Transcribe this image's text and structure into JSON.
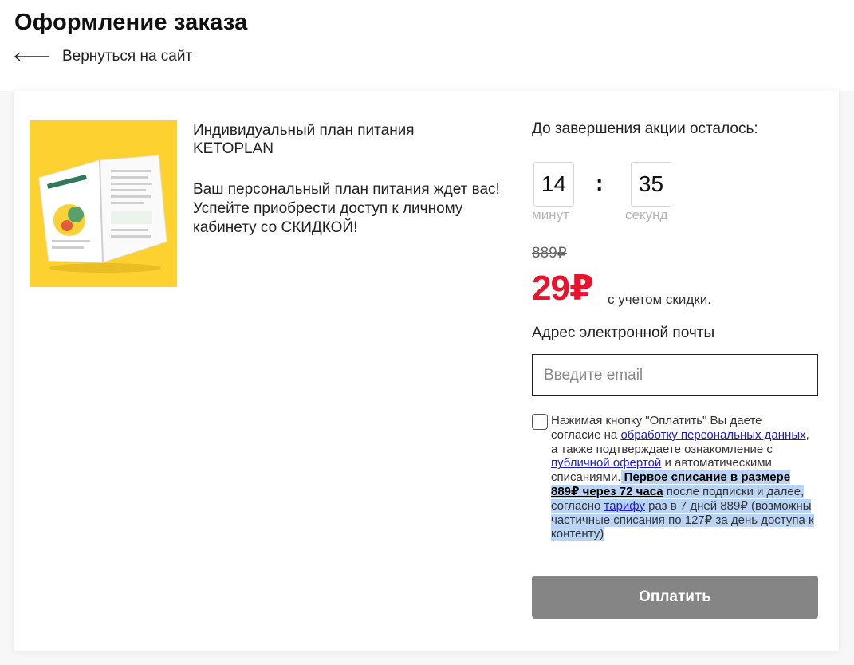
{
  "header": {
    "title": "Оформление заказа",
    "back_label": "Вернуться на сайт"
  },
  "product": {
    "name": "Индивидуальный план питания KETOPLAN",
    "description": "Ваш персональный план питания ждет вас! Успейте приобрести доступ к личному кабинету со СКИДКОЙ!",
    "image_bg": "#fdd230"
  },
  "timer": {
    "caption": "До завершения акции осталось:",
    "minutes": "14",
    "seconds": "35",
    "separator": ":",
    "minutes_label": "минут",
    "seconds_label": "секунд"
  },
  "price": {
    "old": "889₽",
    "new": "29₽",
    "note": "с учетом скидки.",
    "accent_color": "#e8132c"
  },
  "email": {
    "label": "Адрес электронной почты",
    "placeholder": "Введите email",
    "value": ""
  },
  "consent": {
    "checked": false,
    "text_1": "Нажимая кнопку \"Оплатить\" Вы даете согласие на ",
    "link_personal_data": "обработку персональных данных",
    "text_2": ", а также подтверждаете ознакомление с ",
    "link_offer": "публичной офертой",
    "text_3": " и автоматическими списаниями.",
    "bold_first_charge": "Первое списание в размере 889₽ через 72 часа",
    "text_4": " после подписки и далее, согласно ",
    "link_tariff": "тарифу",
    "text_5": " раз в 7 дней 889₽ (возможны частичные списания по 127₽ за день доступа к контенту)"
  },
  "pay_button": {
    "label": "Оплатить",
    "color": "#858585"
  }
}
